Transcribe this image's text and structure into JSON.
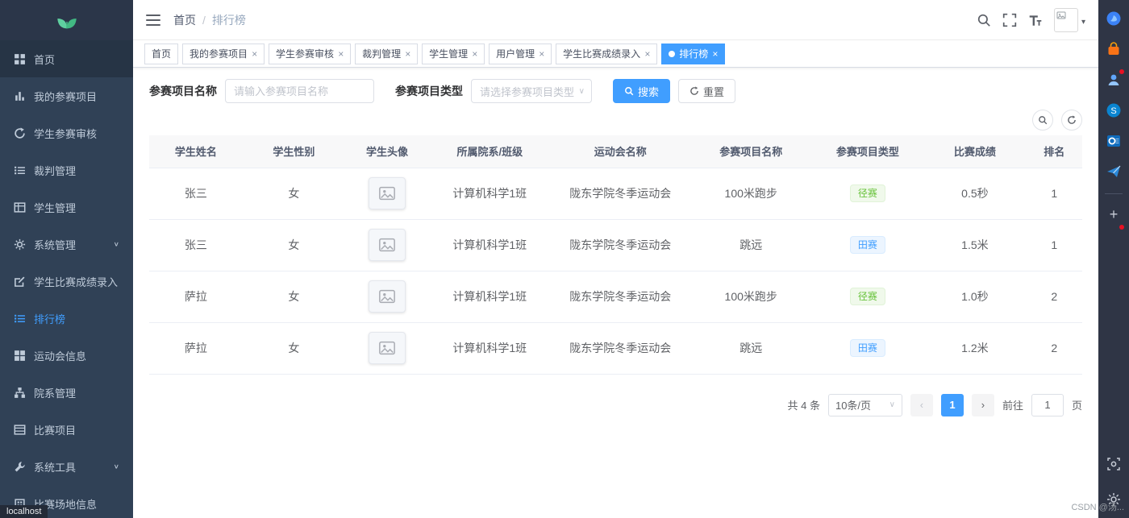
{
  "meta": {
    "accent_color": "#409EFF",
    "sidebar_bg": "#304156",
    "statusbar_text": "localhost",
    "watermark": "CSDN @汤...",
    "glyphs": {
      "close": "×",
      "caret": "▾",
      "chevron": "∨",
      "prev": "‹",
      "next": "›",
      "plus": "+"
    }
  },
  "topbar": {
    "breadcrumb": {
      "root": "首页",
      "separator": "/",
      "current": "排行榜"
    }
  },
  "sidebar": {
    "items": [
      {
        "label": "首页",
        "icon": "dashboard-icon"
      },
      {
        "label": "我的参赛项目",
        "icon": "bar-chart-icon"
      },
      {
        "label": "学生参赛审核",
        "icon": "audit-cycle-icon"
      },
      {
        "label": "裁判管理",
        "icon": "list-icon"
      },
      {
        "label": "学生管理",
        "icon": "table-icon"
      },
      {
        "label": "系统管理",
        "icon": "gear-icon"
      },
      {
        "label": "学生比赛成绩录入",
        "icon": "score-entry-icon"
      },
      {
        "label": "排行榜",
        "icon": "ranking-list-icon"
      },
      {
        "label": "运动会信息",
        "icon": "grid-icon"
      },
      {
        "label": "院系管理",
        "icon": "tree-icon"
      },
      {
        "label": "比赛项目",
        "icon": "project-table-icon"
      },
      {
        "label": "系统工具",
        "icon": "wrench-icon"
      },
      {
        "label": "比赛场地信息",
        "icon": "building-icon"
      }
    ]
  },
  "tabs": [
    {
      "label": "首页"
    },
    {
      "label": "我的参赛项目"
    },
    {
      "label": "学生参赛审核"
    },
    {
      "label": "裁判管理"
    },
    {
      "label": "学生管理"
    },
    {
      "label": "用户管理"
    },
    {
      "label": "学生比赛成绩录入"
    },
    {
      "label": "排行榜"
    }
  ],
  "filters": {
    "name_label": "参赛项目名称",
    "name_placeholder": "请输入参赛项目名称",
    "type_label": "参赛项目类型",
    "type_placeholder": "请选择参赛项目类型",
    "search_button": "搜索",
    "reset_button": "重置"
  },
  "table": {
    "columns": [
      "学生姓名",
      "学生性别",
      "学生头像",
      "所属院系/班级",
      "运动会名称",
      "参赛项目名称",
      "参赛项目类型",
      "比赛成绩",
      "排名"
    ],
    "rows": [
      {
        "name": "张三",
        "gender": "女",
        "dept": "计算机科学1班",
        "meet": "陇东学院冬季运动会",
        "project": "100米跑步",
        "type": "径赛",
        "type_class": "tag tag-green",
        "score": "0.5秒",
        "rank": "1"
      },
      {
        "name": "张三",
        "gender": "女",
        "dept": "计算机科学1班",
        "meet": "陇东学院冬季运动会",
        "project": "跳远",
        "type": "田赛",
        "type_class": "tag tag-blue",
        "score": "1.5米",
        "rank": "1"
      },
      {
        "name": "萨拉",
        "gender": "女",
        "dept": "计算机科学1班",
        "meet": "陇东学院冬季运动会",
        "project": "100米跑步",
        "type": "径赛",
        "type_class": "tag tag-green",
        "score": "1.0秒",
        "rank": "2"
      },
      {
        "name": "萨拉",
        "gender": "女",
        "dept": "计算机科学1班",
        "meet": "陇东学院冬季运动会",
        "project": "跳远",
        "type": "田赛",
        "type_class": "tag tag-blue",
        "score": "1.2米",
        "rank": "2"
      }
    ]
  },
  "pagination": {
    "total_text": "共 4 条",
    "page_size": "10条/页",
    "current_page": "1",
    "goto_label": "前往",
    "goto_value": "1",
    "goto_suffix": "页"
  }
}
